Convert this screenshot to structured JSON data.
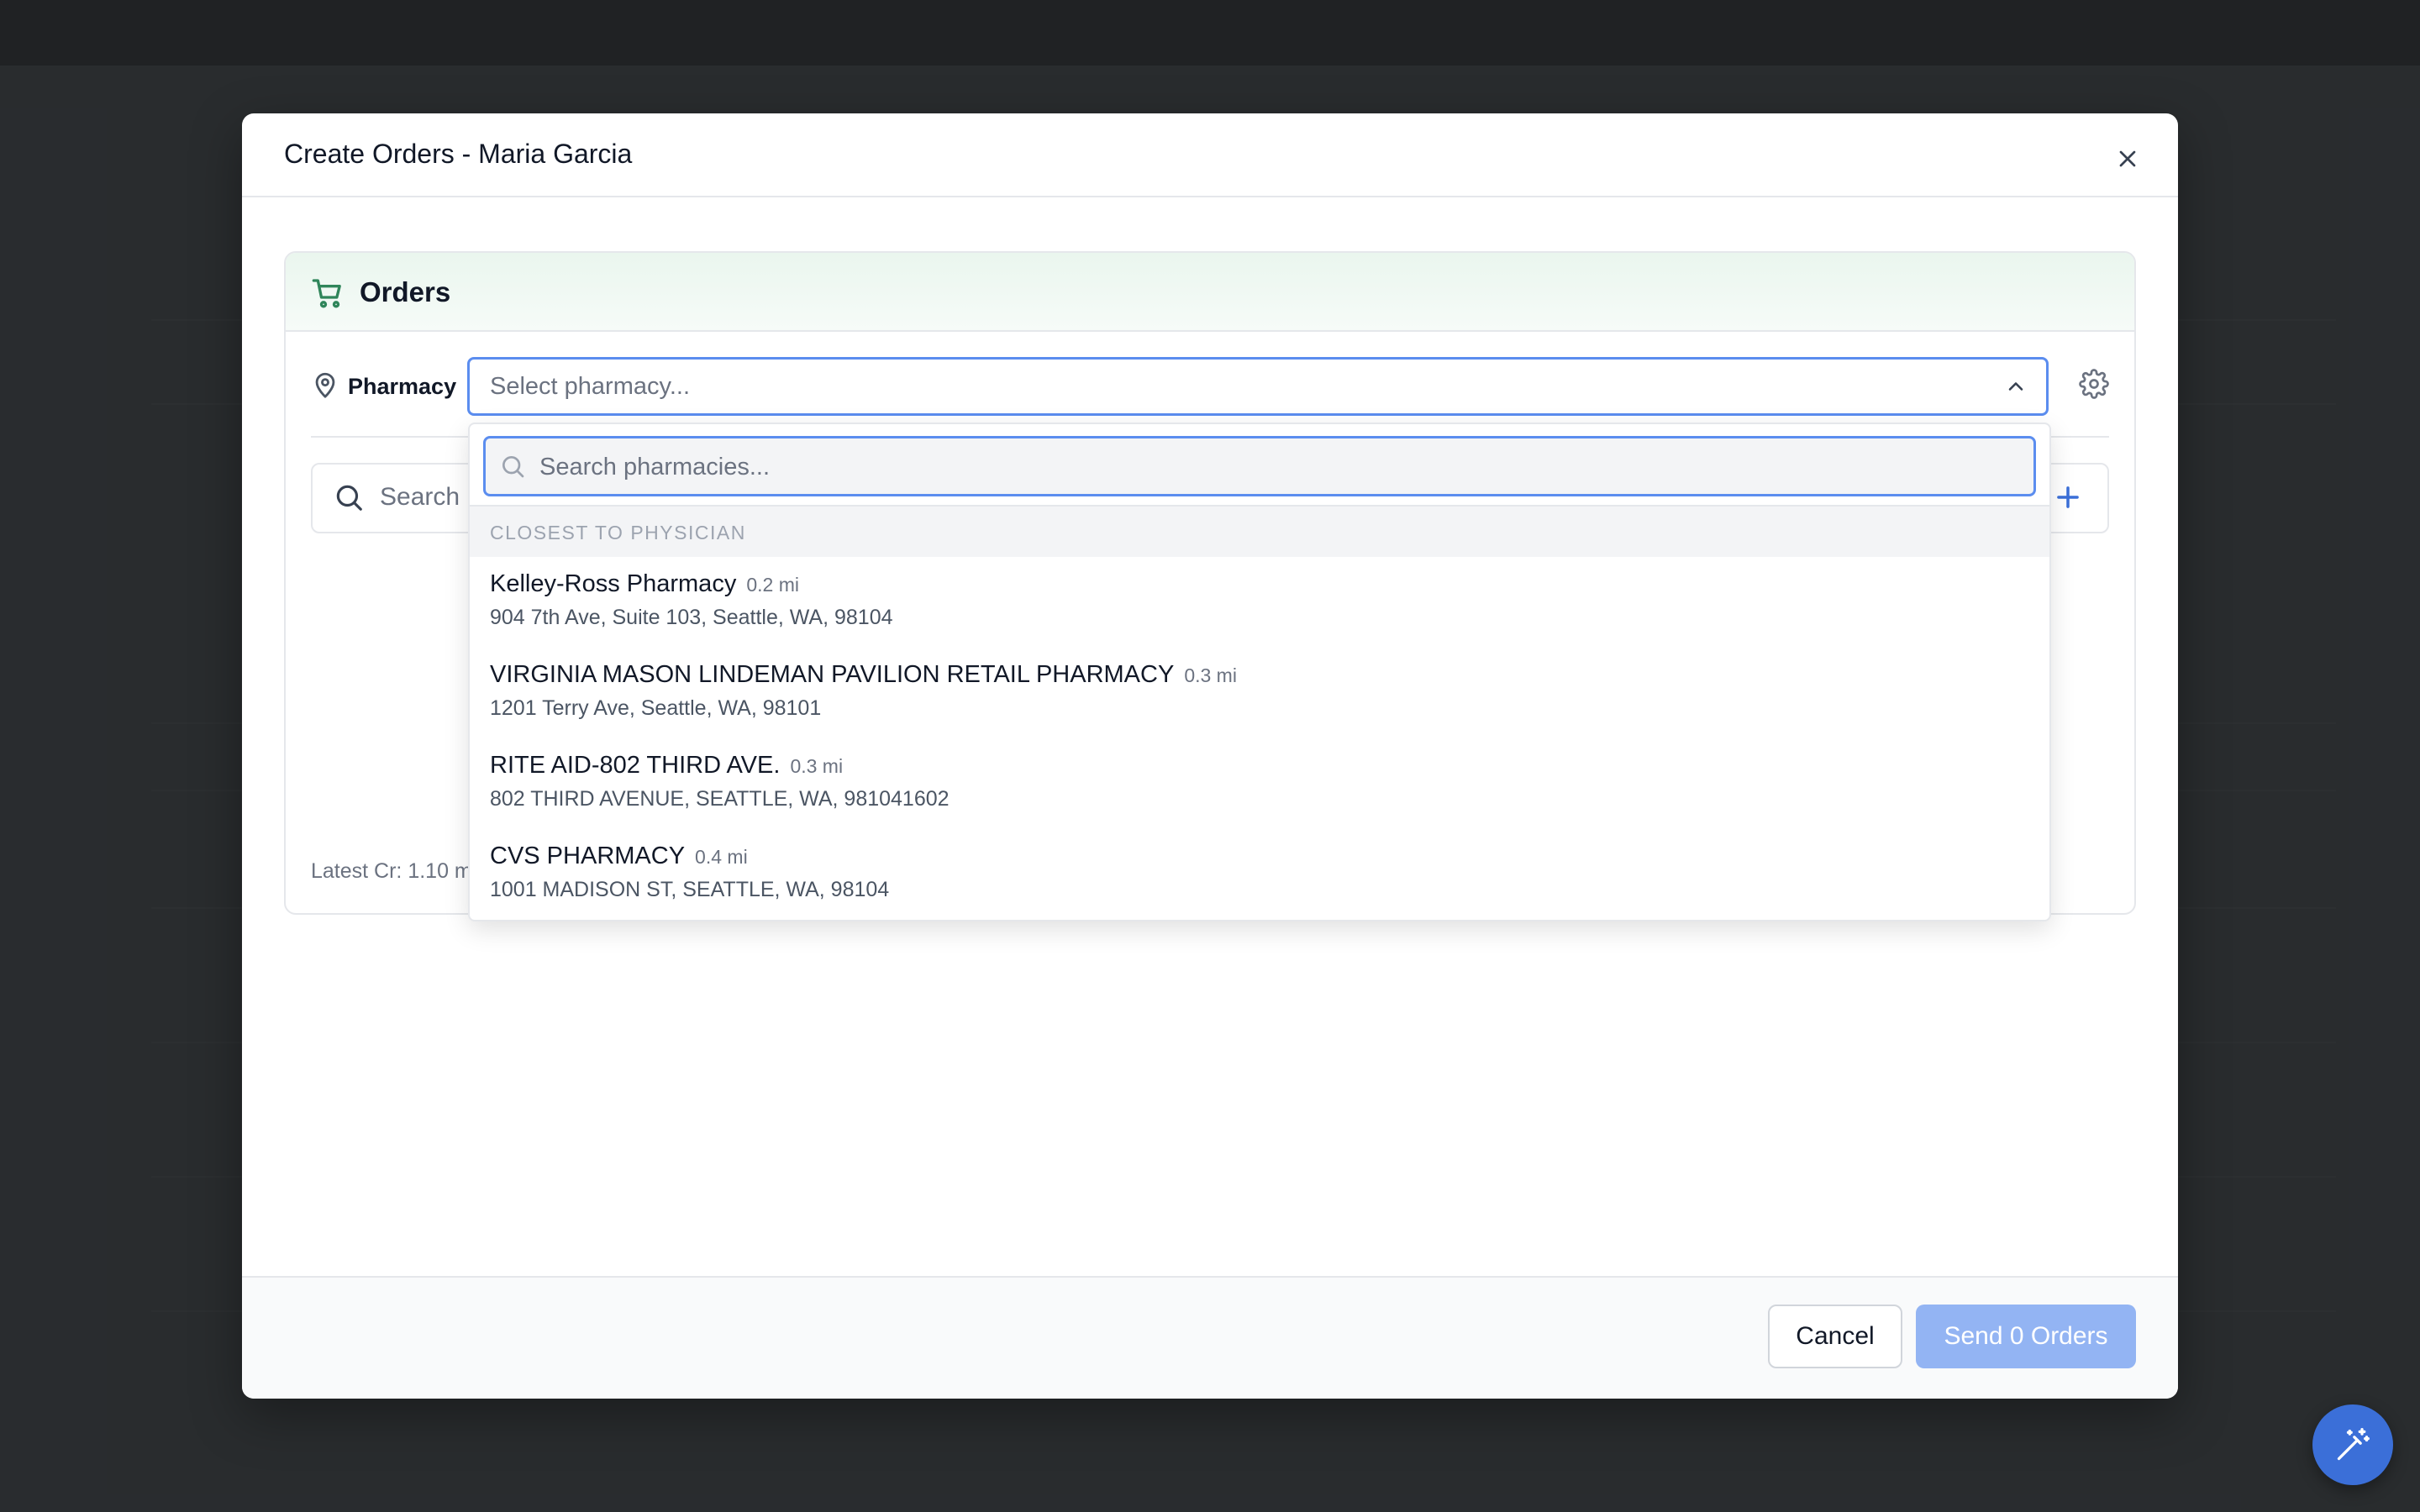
{
  "modal": {
    "title": "Create Orders - Maria Garcia",
    "close_icon": "close-icon"
  },
  "orders": {
    "title": "Orders",
    "icon": "shopping-cart-icon",
    "accent_color": "#2f855a",
    "pharmacy": {
      "label": "Pharmacy",
      "placeholder": "Select pharmacy...",
      "expanded": true
    },
    "search": {
      "placeholder": "Search"
    },
    "latest_cr": "Latest Cr: 1.10 m"
  },
  "dropdown": {
    "search_placeholder": "Search pharmacies...",
    "group_label": "CLOSEST TO PHYSICIAN",
    "items": [
      {
        "name": "Kelley-Ross Pharmacy",
        "distance": "0.2 mi",
        "address": "904 7th Ave, Suite 103, Seattle, WA, 98104"
      },
      {
        "name": "VIRGINIA MASON LINDEMAN PAVILION RETAIL PHARMACY",
        "distance": "0.3 mi",
        "address": "1201 Terry Ave, Seattle, WA, 98101"
      },
      {
        "name": "RITE AID-802 THIRD AVE.",
        "distance": "0.3 mi",
        "address": "802 THIRD AVENUE, SEATTLE, WA, 981041602"
      },
      {
        "name": "CVS PHARMACY",
        "distance": "0.4 mi",
        "address": "1001 MADISON ST, SEATTLE, WA, 98104"
      }
    ]
  },
  "footer": {
    "cancel_label": "Cancel",
    "send_label": "Send 0 Orders",
    "send_color": "#93b4f3"
  },
  "fab": {
    "icon": "magic-wand-icon",
    "color": "#3b6fd8"
  }
}
